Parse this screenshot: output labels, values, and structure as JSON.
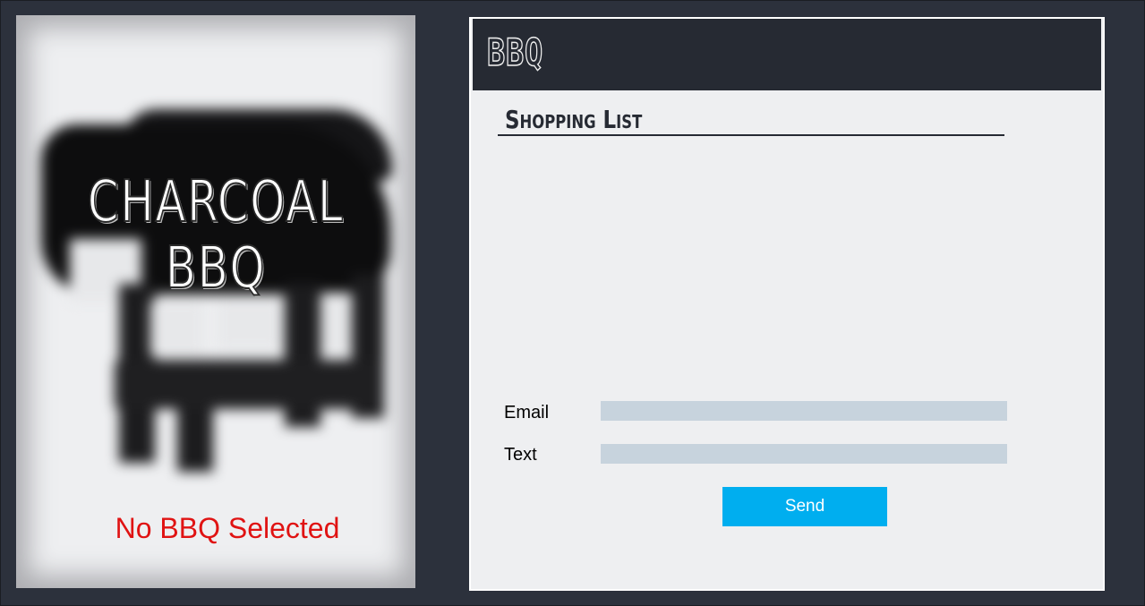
{
  "product_card": {
    "title": "CHARCOAL BBQ",
    "status": "No BBQ Selected",
    "status_color": "#e01313",
    "image": "blurred-charcoal-grill-illustration"
  },
  "panel": {
    "title": "BBQ",
    "section_title": "Shopping List",
    "shopping_list_items": [],
    "form": {
      "email_label": "Email",
      "email_value": "",
      "text_label": "Text",
      "text_value": "",
      "send_label": "Send"
    }
  },
  "colors": {
    "background": "#2c313c",
    "header": "#262a33",
    "panel": "#eeeff1",
    "input": "#c7d3dd",
    "accent": "#00aeef"
  }
}
